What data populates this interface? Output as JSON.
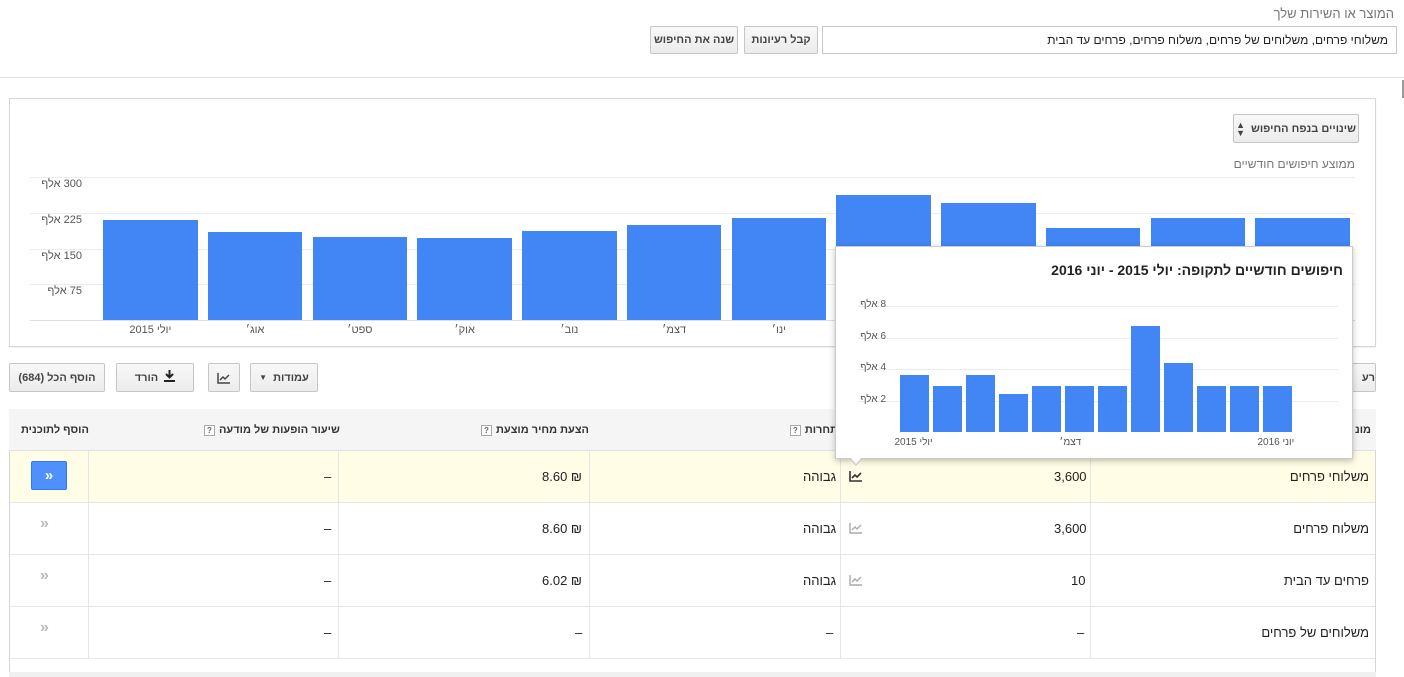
{
  "search": {
    "label": "המוצר או השירות שלך",
    "value": "משלוחי פרחים, משלוחים של פרחים, משלוח פרחים, פרחים עד הבית",
    "get_ideas": "קבל רעיונות",
    "modify_search": "שנה את החיפוש"
  },
  "chart_panel": {
    "changes_button": "שינויים בנפח החיפוש",
    "subtitle": "ממוצע חיפושים חודשיים"
  },
  "chart_data": [
    {
      "type": "bar",
      "ylim": [
        0,
        300000
      ],
      "y_ticks": [
        "300 אלף",
        "225 אלף",
        "150 אלף",
        "75 אלף"
      ],
      "y_tick_values": [
        300000,
        225000,
        150000,
        75000
      ],
      "x_tick_labels": [
        "יולי 2015",
        "אוג׳",
        "ספט׳",
        "אוק׳",
        "נוב׳",
        "דצמ׳",
        "ינו׳"
      ],
      "values": [
        210000,
        185000,
        175000,
        171000,
        186000,
        200000,
        213000,
        263000,
        245000,
        193000,
        214000,
        213000
      ],
      "grid": true
    },
    {
      "type": "bar",
      "title": "חיפושים חודשיים לתקופה: יולי 2015 - יוני 2016",
      "ylim": [
        0,
        8000
      ],
      "y_ticks": [
        "8 אלף",
        "6 אלף",
        "4 אלף",
        "2 אלף"
      ],
      "y_tick_values": [
        8000,
        6000,
        4000,
        2000
      ],
      "x_tick_labels": [
        "יולי 2015",
        "דצמ׳",
        "יוני 2016"
      ],
      "values": [
        3600,
        2900,
        3600,
        2400,
        2900,
        2900,
        2900,
        6700,
        4400,
        2900,
        2900,
        2900
      ],
      "grid": true
    }
  ],
  "toolbar": {
    "columns": "עמודות",
    "download": "הורד",
    "add_all": "הוסף הכל (684)",
    "cut_right": "רע"
  },
  "table": {
    "headers": {
      "keyword": "מונ",
      "competition": "תחרות",
      "suggested_bid": "הצעת מחיר מוצעת",
      "ad_impression_share": "שיעור הופעות של מודעה",
      "add_to_plan": "הוסף לתוכנית"
    },
    "rows": [
      {
        "keyword": "משלוחי פרחים",
        "searches": "3,600",
        "competition": "גבוהה",
        "bid": "₪ 8.60",
        "share": "–"
      },
      {
        "keyword": "משלוח פרחים",
        "searches": "3,600",
        "competition": "גבוהה",
        "bid": "₪ 8.60",
        "share": "–"
      },
      {
        "keyword": "פרחים עד הבית",
        "searches": "10",
        "competition": "גבוהה",
        "bid": "₪ 6.02",
        "share": "–"
      },
      {
        "keyword": "משלוחים של פרחים",
        "searches": "–",
        "competition": "–",
        "bid": "–",
        "share": "–"
      }
    ],
    "add_symbol": "»"
  },
  "colors": {
    "bar": "#4285f4",
    "add_button": "#4d90fe",
    "highlight_row": "#fffde6"
  }
}
